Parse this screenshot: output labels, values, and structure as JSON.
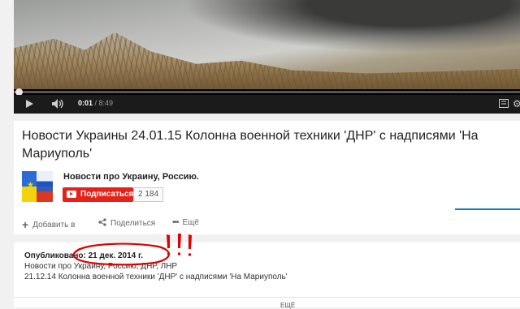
{
  "player": {
    "current_time": "0:01",
    "separator": " / ",
    "duration": "8:49",
    "progress_fraction": 0.002,
    "play_icon": "play-icon",
    "volume_icon": "volume-icon",
    "hd_icon": "hd-icon",
    "settings_icon": "gear-icon"
  },
  "video": {
    "title": "Новости Украины 24.01.15 Колонна военной техники 'ДНР' с надписями 'На Мариуполь'"
  },
  "channel": {
    "name": "Новости про Украину, Россию.",
    "subscribe_label": "Подписаться",
    "subscriber_count": "2 184"
  },
  "actions": {
    "add_label": "Добавить в",
    "share_label": "Поделиться",
    "more_label": "Ещё"
  },
  "description": {
    "published_prefix": "Опубликовано: ",
    "published_date": "21 дек. 2014 г.",
    "line1": "Новости про Украину, Россию, ДНР, ЛНР",
    "line2": "21.12.14 Колонна военной техники 'ДНР' с надписями 'На Мариуполь'",
    "more_link": "ЕЩЁ"
  },
  "annotation": {
    "text": "!!!",
    "color": "#e00000"
  },
  "colors": {
    "accent_red": "#e62117",
    "link_blue": "#167ac6"
  }
}
